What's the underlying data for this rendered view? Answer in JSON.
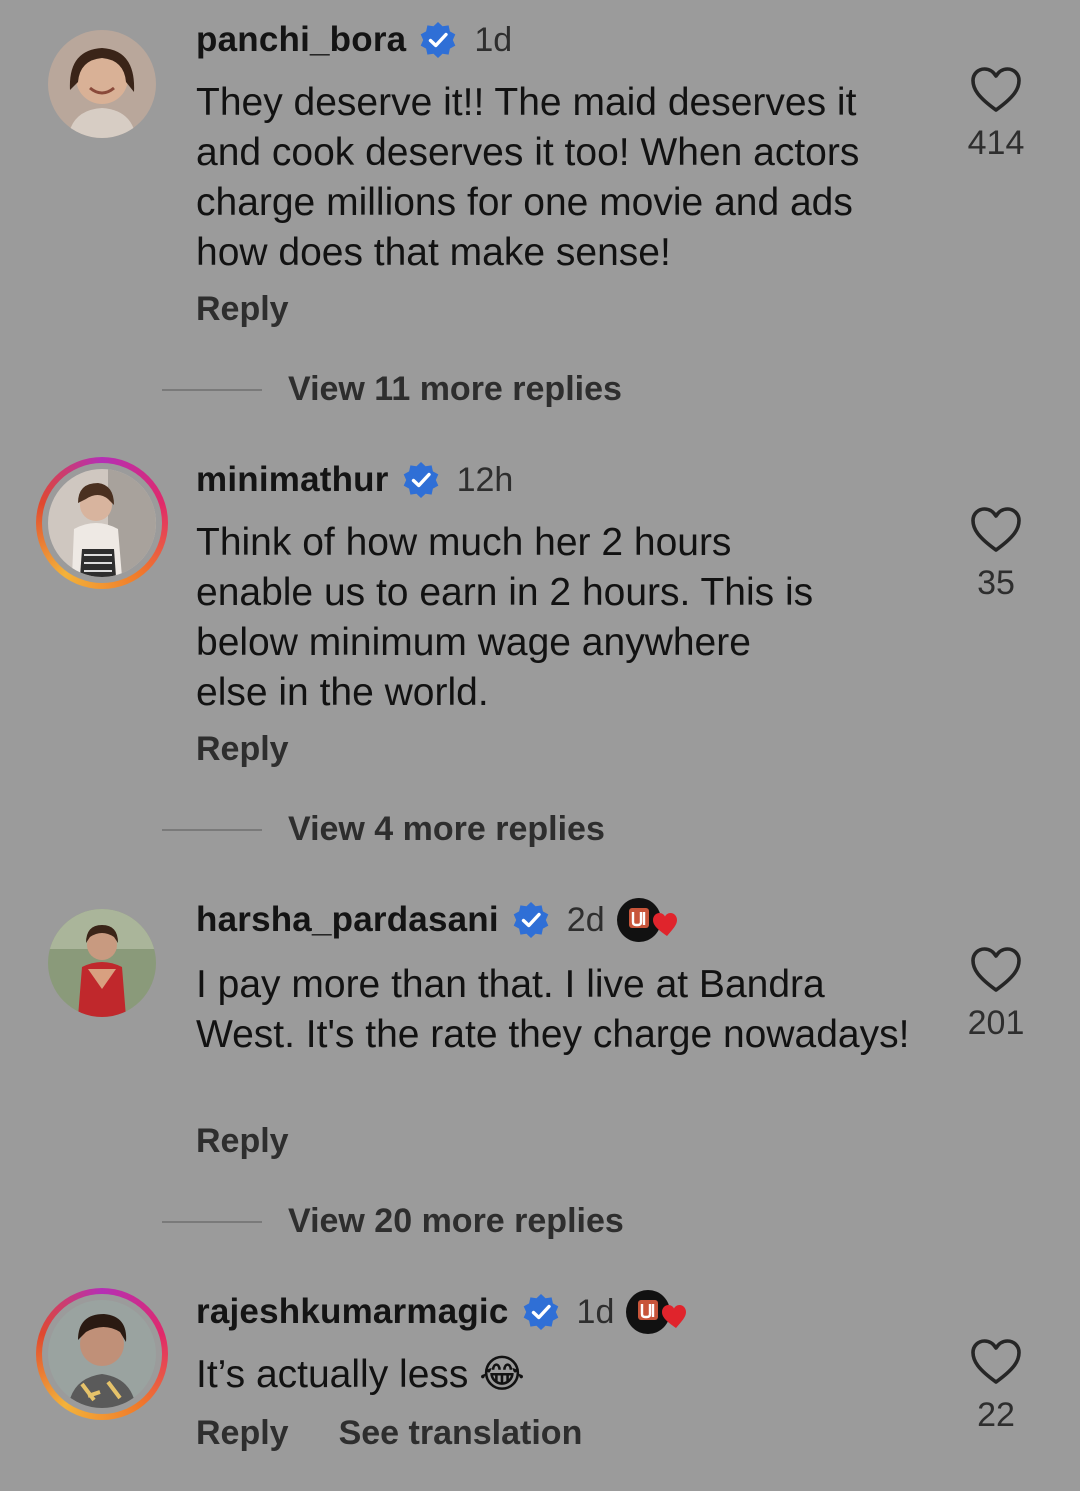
{
  "comments": [
    {
      "username": "panchi_bora",
      "time": "1d",
      "text": "They deserve it!! The maid deserves it and cook deserves it too! When actors charge millions for one movie and ads how does that make sense!",
      "likes": "414",
      "reply_label": "Reply",
      "view_replies": "View 11 more replies"
    },
    {
      "username": "minimathur",
      "time": "12h",
      "text": "Think of how much her 2 hours enable us to earn in 2 hours. This is below minimum wage anywhere else in the world.",
      "likes": "35",
      "reply_label": "Reply",
      "view_replies": "View 4 more replies"
    },
    {
      "username": "harsha_pardasani",
      "time": "2d",
      "text": "I pay more than that. I live at Bandra West. It's the rate they charge nowadays!",
      "likes": "201",
      "reply_label": "Reply",
      "view_replies": "View 20 more replies"
    },
    {
      "username": "rajeshkumarmagic",
      "time": "1d",
      "text": "It’s actually less 😂",
      "likes": "22",
      "reply_label": "Reply",
      "see_translation": "See translation"
    }
  ],
  "colors": {
    "background": "#9b9b9b",
    "verified": "#2f6fd6",
    "badge_heart": "#e0242c"
  }
}
